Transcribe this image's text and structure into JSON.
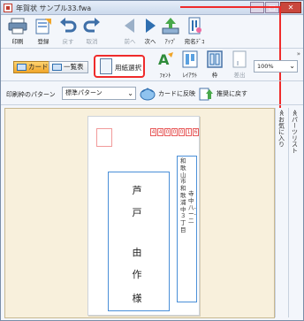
{
  "window": {
    "title": "年賀状 サンプル33.fwa",
    "controls": [
      "—",
      "□",
      "✕"
    ]
  },
  "toolbar": {
    "items": [
      {
        "label": "印刷",
        "icon": "printer-icon",
        "enabled": true
      },
      {
        "label": "登録",
        "icon": "register-icon",
        "enabled": true
      },
      {
        "label": "戻す",
        "icon": "undo-icon",
        "enabled": false
      },
      {
        "label": "取消",
        "icon": "redo-icon",
        "enabled": false
      },
      {
        "label": "前へ",
        "icon": "prev-icon",
        "enabled": false
      },
      {
        "label": "次へ",
        "icon": "next-icon",
        "enabled": true
      },
      {
        "label": "ｱｯﾌﾟ",
        "icon": "upload-icon",
        "enabled": true
      },
      {
        "label": "宛名ﾃﾞｺ",
        "icon": "address-deco-icon",
        "enabled": true
      }
    ]
  },
  "toolbar2": {
    "card_tab": "カード",
    "list_tab": "一覧表",
    "paper_select": "用紙選択",
    "font": "ﾌｫﾝﾄ",
    "layout": "ﾚｲｱｳﾄ",
    "frame": "枠",
    "send": "差出",
    "zoom": "100%"
  },
  "row3": {
    "pattern_label": "印刷枠のパターン",
    "pattern_value": "標準パターン",
    "reflect_button": "カードに反映",
    "recommend_button": "推奨に戻す"
  },
  "card": {
    "postal_digits": [
      "4",
      "4",
      "0",
      "0",
      "0",
      "1",
      "6"
    ],
    "address_line1": "和歌山市和歌浦中３丁目",
    "address_line2": "寺中八‐ー‐二",
    "name_chars": [
      "芦",
      "戸",
      "由",
      "作",
      "様"
    ]
  },
  "side": {
    "favorites": "≪お気に入り",
    "parts_list": "≪パーツリスト"
  },
  "colors": {
    "accent": "#ef2b2b",
    "canvas": "#f8f0dc",
    "frame_blue": "#4a8fd8",
    "postal_red": "#e85a5a"
  }
}
